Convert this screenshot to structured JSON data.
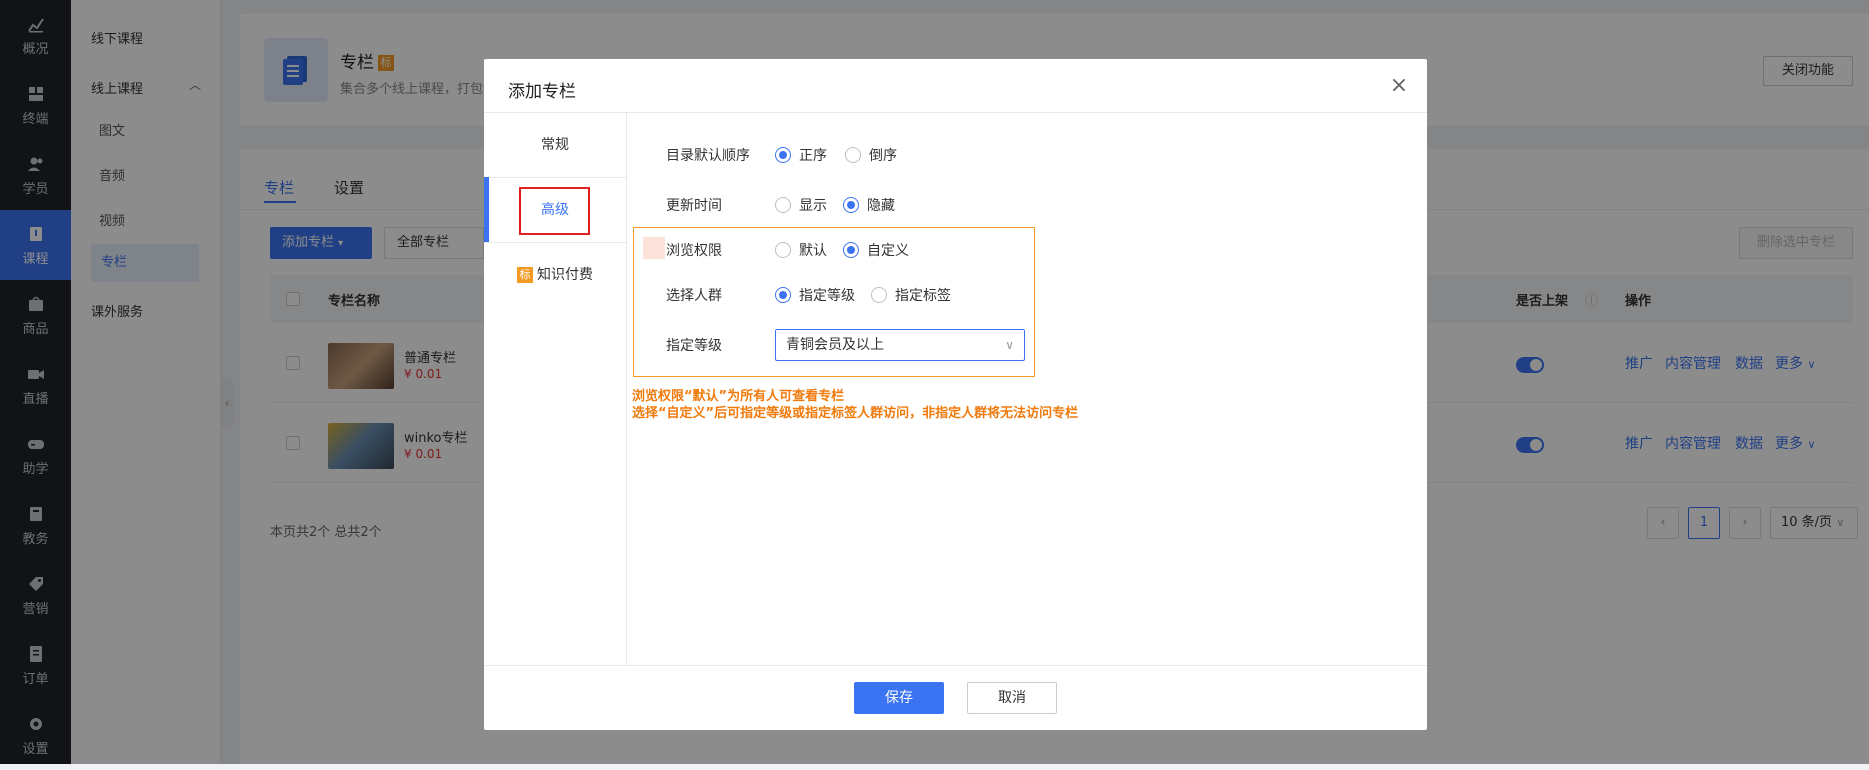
{
  "rail": {
    "items": [
      {
        "label": "概况",
        "icon": "chart-icon"
      },
      {
        "label": "终端",
        "icon": "grid-icon"
      },
      {
        "label": "学员",
        "icon": "users-icon"
      },
      {
        "label": "课程",
        "icon": "book-icon"
      },
      {
        "label": "商品",
        "icon": "bag-icon"
      },
      {
        "label": "直播",
        "icon": "video-icon"
      },
      {
        "label": "助学",
        "icon": "gamepad-icon"
      },
      {
        "label": "教务",
        "icon": "notebook-icon"
      },
      {
        "label": "营销",
        "icon": "tag-icon"
      },
      {
        "label": "订单",
        "icon": "receipt-icon"
      },
      {
        "label": "设置",
        "icon": "gear-icon"
      }
    ]
  },
  "subnav": {
    "offline": "线下课程",
    "online": "线上课程",
    "online_items": [
      "图文",
      "音频",
      "视频",
      "专栏"
    ],
    "extra": "课外服务"
  },
  "header": {
    "title": "专栏",
    "badge": "标",
    "desc": "集合多个线上课程，打包",
    "close_button": "关闭功能"
  },
  "list": {
    "tabs": [
      "专栏",
      "设置"
    ],
    "add_button": "添加专栏",
    "filter": "全部专栏",
    "delete_button": "删除选中专栏",
    "columns": {
      "name": "专栏名称",
      "on_shelf": "是否上架",
      "ops": "操作"
    },
    "rows": [
      {
        "name": "普通专栏",
        "price": "¥ 0.01"
      },
      {
        "name": "winko专栏",
        "price": "¥ 0.01"
      }
    ],
    "ops": [
      "推广",
      "内容管理",
      "数据",
      "更多"
    ],
    "summary": "本页共2个 总共2个",
    "page": "1",
    "page_size": "10 条/页"
  },
  "modal": {
    "title": "添加专栏",
    "side": [
      "常规",
      "高级",
      "知识付费"
    ],
    "side_badge": "标",
    "form": {
      "order_label": "目录默认顺序",
      "order_opts": [
        "正序",
        "倒序"
      ],
      "time_label": "更新时间",
      "time_opts": [
        "显示",
        "隐藏"
      ],
      "perm_label": "浏览权限",
      "perm_opts": [
        "默认",
        "自定义"
      ],
      "crowd_label": "选择人群",
      "crowd_opts": [
        "指定等级",
        "指定标签"
      ],
      "level_label": "指定等级",
      "level_value": "青铜会员及以上"
    },
    "notes": [
      "浏览权限“默认”为所有人可查看专栏",
      "选择“自定义”后可指定等级或指定标签人群访问，非指定人群将无法访问专栏"
    ],
    "save": "保存",
    "cancel": "取消"
  }
}
